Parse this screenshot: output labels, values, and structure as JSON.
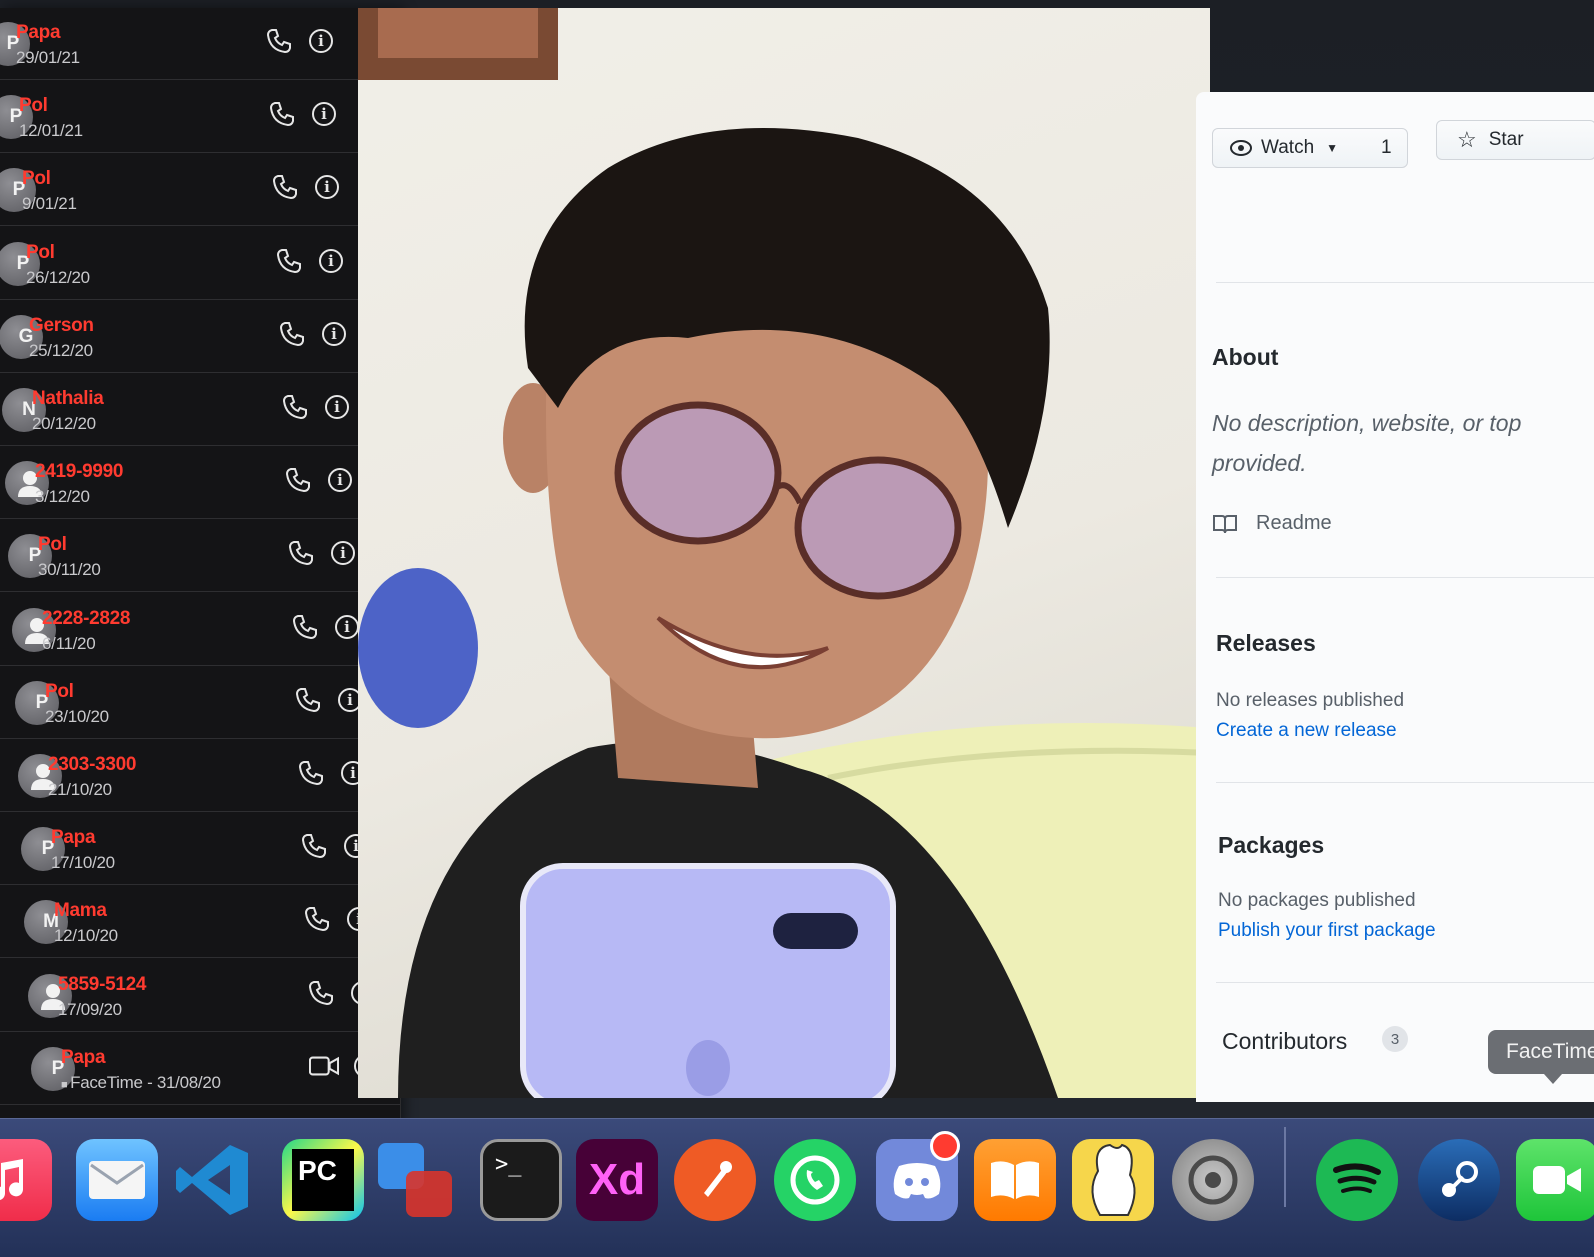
{
  "calls": [
    {
      "name": "Papa",
      "date": "29/01/21",
      "avatar": "P",
      "type": "audio"
    },
    {
      "name": "Pol",
      "date": "12/01/21",
      "avatar": "P",
      "type": "audio"
    },
    {
      "name": "Pol",
      "date": "9/01/21",
      "avatar": "P",
      "type": "audio"
    },
    {
      "name": "Pol",
      "date": "26/12/20",
      "avatar": "P",
      "type": "audio"
    },
    {
      "name": "Gerson",
      "date": "25/12/20",
      "avatar": "G",
      "type": "audio"
    },
    {
      "name": "Nathalia",
      "date": "20/12/20",
      "avatar": "N",
      "type": "audio"
    },
    {
      "name": "2419-9990",
      "date": "3/12/20",
      "avatar": "",
      "type": "audio"
    },
    {
      "name": "Pol",
      "date": "30/11/20",
      "avatar": "P",
      "type": "audio"
    },
    {
      "name": "2228-2828",
      "date": "6/11/20",
      "avatar": "",
      "type": "audio"
    },
    {
      "name": "Pol",
      "date": "23/10/20",
      "avatar": "P",
      "type": "audio"
    },
    {
      "name": "2303-3300",
      "date": "21/10/20",
      "avatar": "",
      "type": "audio"
    },
    {
      "name": "Papa",
      "date": "17/10/20",
      "avatar": "P",
      "type": "audio"
    },
    {
      "name": "Mama",
      "date": "12/10/20",
      "avatar": "M",
      "type": "audio"
    },
    {
      "name": "5859-5124",
      "date": "17/09/20",
      "avatar": "",
      "type": "audio"
    },
    {
      "name": "Papa",
      "date": "FaceTime - 31/08/20",
      "avatar": "P",
      "type": "video"
    }
  ],
  "github": {
    "watch_label": "Watch",
    "watch_count": "1",
    "star_label": "Star",
    "about_title": "About",
    "about_text_line1": "No description, website, or top",
    "about_text_line2": "provided.",
    "readme_label": "Readme",
    "releases_title": "Releases",
    "releases_empty": "No releases published",
    "releases_link": "Create a new release",
    "packages_title": "Packages",
    "packages_empty": "No packages published",
    "packages_link": "Publish your first package",
    "contributors_title": "Contributors",
    "contributors_count": "3"
  },
  "tooltip": {
    "label": "FaceTime"
  },
  "dock": {
    "apps": [
      "music-icon",
      "mail-icon",
      "vscode-icon",
      "pycharm-icon",
      "remote-desktop-icon",
      "terminal-icon",
      "adobe-xd-icon",
      "postman-icon",
      "whatsapp-icon",
      "discord-icon",
      "books-icon",
      "finder-friend-icon",
      "system-preferences-icon",
      "spotify-icon",
      "steam-icon",
      "facetime-icon"
    ],
    "labels": {
      "xd": "Xd",
      "pycharm": "PC"
    }
  },
  "colors": {
    "missed_call": "#ff3b30",
    "github_link": "#0366d6",
    "dock": "#2b3a68"
  }
}
